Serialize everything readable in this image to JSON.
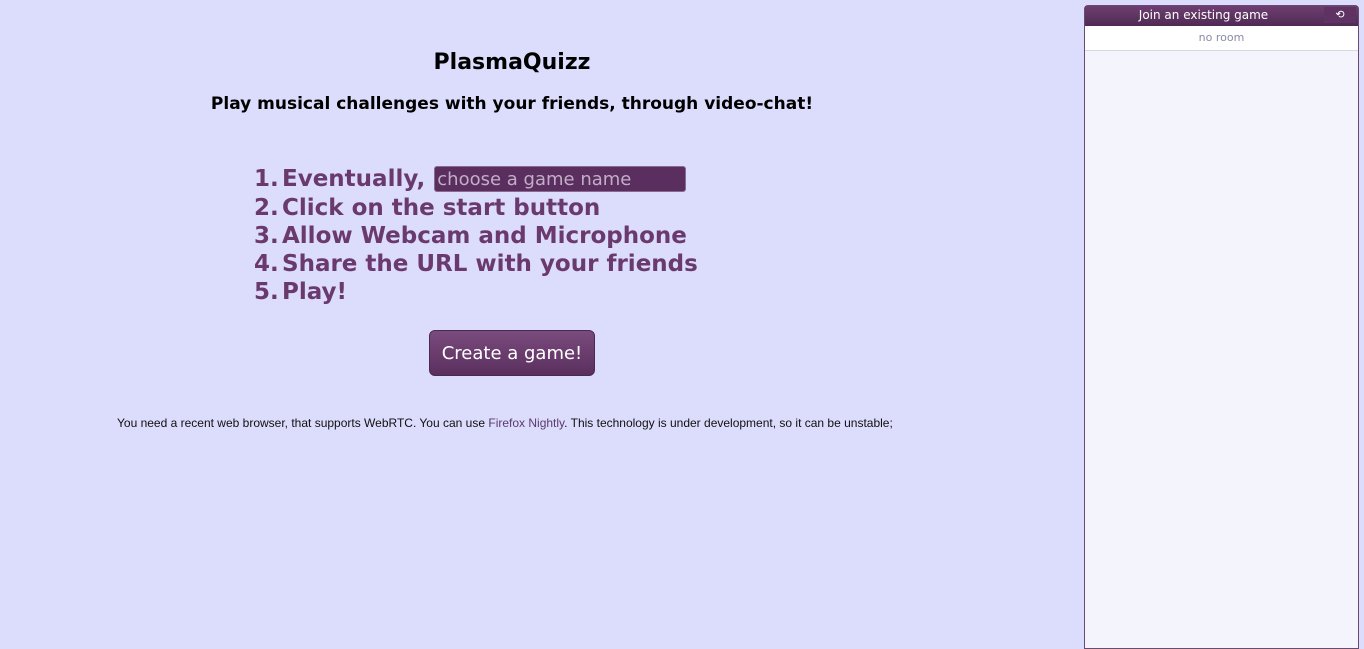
{
  "app": {
    "title": "PlasmaQuizz",
    "subtitle": "Play musical challenges with your friends, through video-chat!"
  },
  "steps": [
    {
      "num": "1.",
      "label": "Eventually,"
    },
    {
      "num": "2.",
      "label": "Click on the start button"
    },
    {
      "num": "3.",
      "label": "Allow Webcam and Microphone"
    },
    {
      "num": "4.",
      "label": "Share the URL with your friends"
    },
    {
      "num": "5.",
      "label": "Play!"
    }
  ],
  "game_name_input": {
    "value": "",
    "placeholder": "choose a game name"
  },
  "create_button": {
    "label": "Create a game!"
  },
  "notice": {
    "before": "You need a recent web browser, that supports WebRTC. You can use ",
    "link": "Firefox Nightly",
    "after": ". This technology is under development, so it can be unstable;"
  },
  "join_panel": {
    "title": "Join an existing game",
    "refresh_icon": "refresh-icon",
    "refresh_glyph": "⟲",
    "empty_text": "no room"
  },
  "colors": {
    "background": "#dcdcfc",
    "accent": "#6a3a6e",
    "button": "#5a2f5e"
  }
}
